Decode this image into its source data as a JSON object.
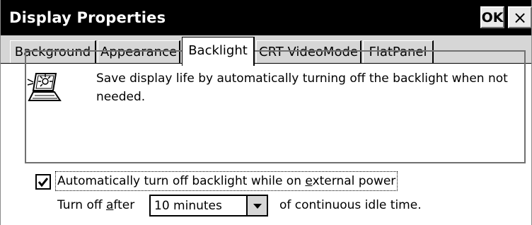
{
  "window": {
    "title": "Display Properties",
    "ok_label": "OK",
    "close_label": "×"
  },
  "tabs": [
    {
      "label": "Background",
      "active": false
    },
    {
      "label": "Appearance",
      "active": false
    },
    {
      "label": "Backlight",
      "active": true
    },
    {
      "label": "CRT VideoMode",
      "active": false
    },
    {
      "label": "FlatPanel",
      "active": false
    }
  ],
  "backlight": {
    "icon": "backlight-laptop-icon",
    "description": "Save display life by automatically turning off the backlight when not needed.",
    "checkbox": {
      "checked": true,
      "label_parts": [
        "Automatically turn off backlight while on ",
        "e",
        "xternal power"
      ]
    },
    "turn_off_parts": [
      "Turn off ",
      "a",
      "fter"
    ],
    "timeout": {
      "selected": "10 minutes",
      "arrow_icon": "dropdown-arrow-icon"
    },
    "idle_suffix": "of continuous idle time."
  }
}
